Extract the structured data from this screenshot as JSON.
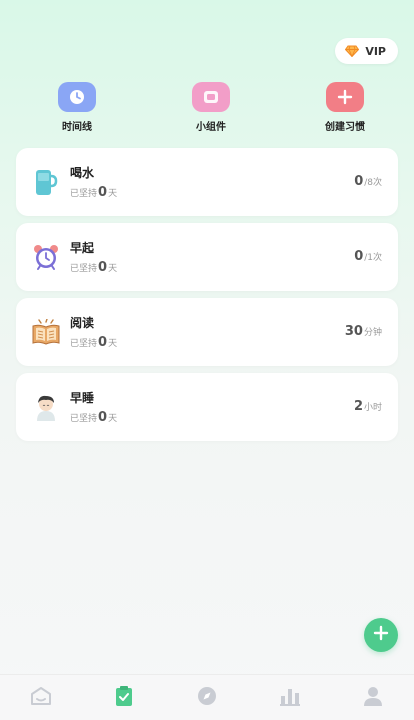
{
  "vip": {
    "label": "VIP",
    "icon": "diamond-icon"
  },
  "quick_actions": [
    {
      "label": "时间线",
      "icon": "clock-icon",
      "color": "#8aa6f5"
    },
    {
      "label": "小组件",
      "icon": "widget-icon",
      "color": "#f29ec8"
    },
    {
      "label": "创建习惯",
      "icon": "plus-icon",
      "color": "#f27e86"
    }
  ],
  "habits": [
    {
      "name": "喝水",
      "icon": "cup-icon",
      "streak_prefix": "已坚持",
      "streak": "0",
      "streak_unit": "天",
      "goal_value": "0",
      "goal_unit": "/8次"
    },
    {
      "name": "早起",
      "icon": "alarm-clock-icon",
      "streak_prefix": "已坚持",
      "streak": "0",
      "streak_unit": "天",
      "goal_value": "0",
      "goal_unit": "/1次"
    },
    {
      "name": "阅读",
      "icon": "book-icon",
      "streak_prefix": "已坚持",
      "streak": "0",
      "streak_unit": "天",
      "goal_value": "30",
      "goal_unit": "分钟"
    },
    {
      "name": "早睡",
      "icon": "sleeping-person-icon",
      "streak_prefix": "已坚持",
      "streak": "0",
      "streak_unit": "天",
      "goal_value": "2",
      "goal_unit": "小时"
    }
  ],
  "fab": {
    "icon": "plus-icon",
    "color": "#4ecb8d"
  },
  "tabs": [
    {
      "icon": "home-icon",
      "active": false
    },
    {
      "icon": "clipboard-check-icon",
      "active": true
    },
    {
      "icon": "compass-icon",
      "active": false
    },
    {
      "icon": "bar-chart-icon",
      "active": false
    },
    {
      "icon": "profile-icon",
      "active": false
    }
  ],
  "colors": {
    "accent": "#4ecb8d",
    "tab_inactive": "#c9ccd3"
  }
}
